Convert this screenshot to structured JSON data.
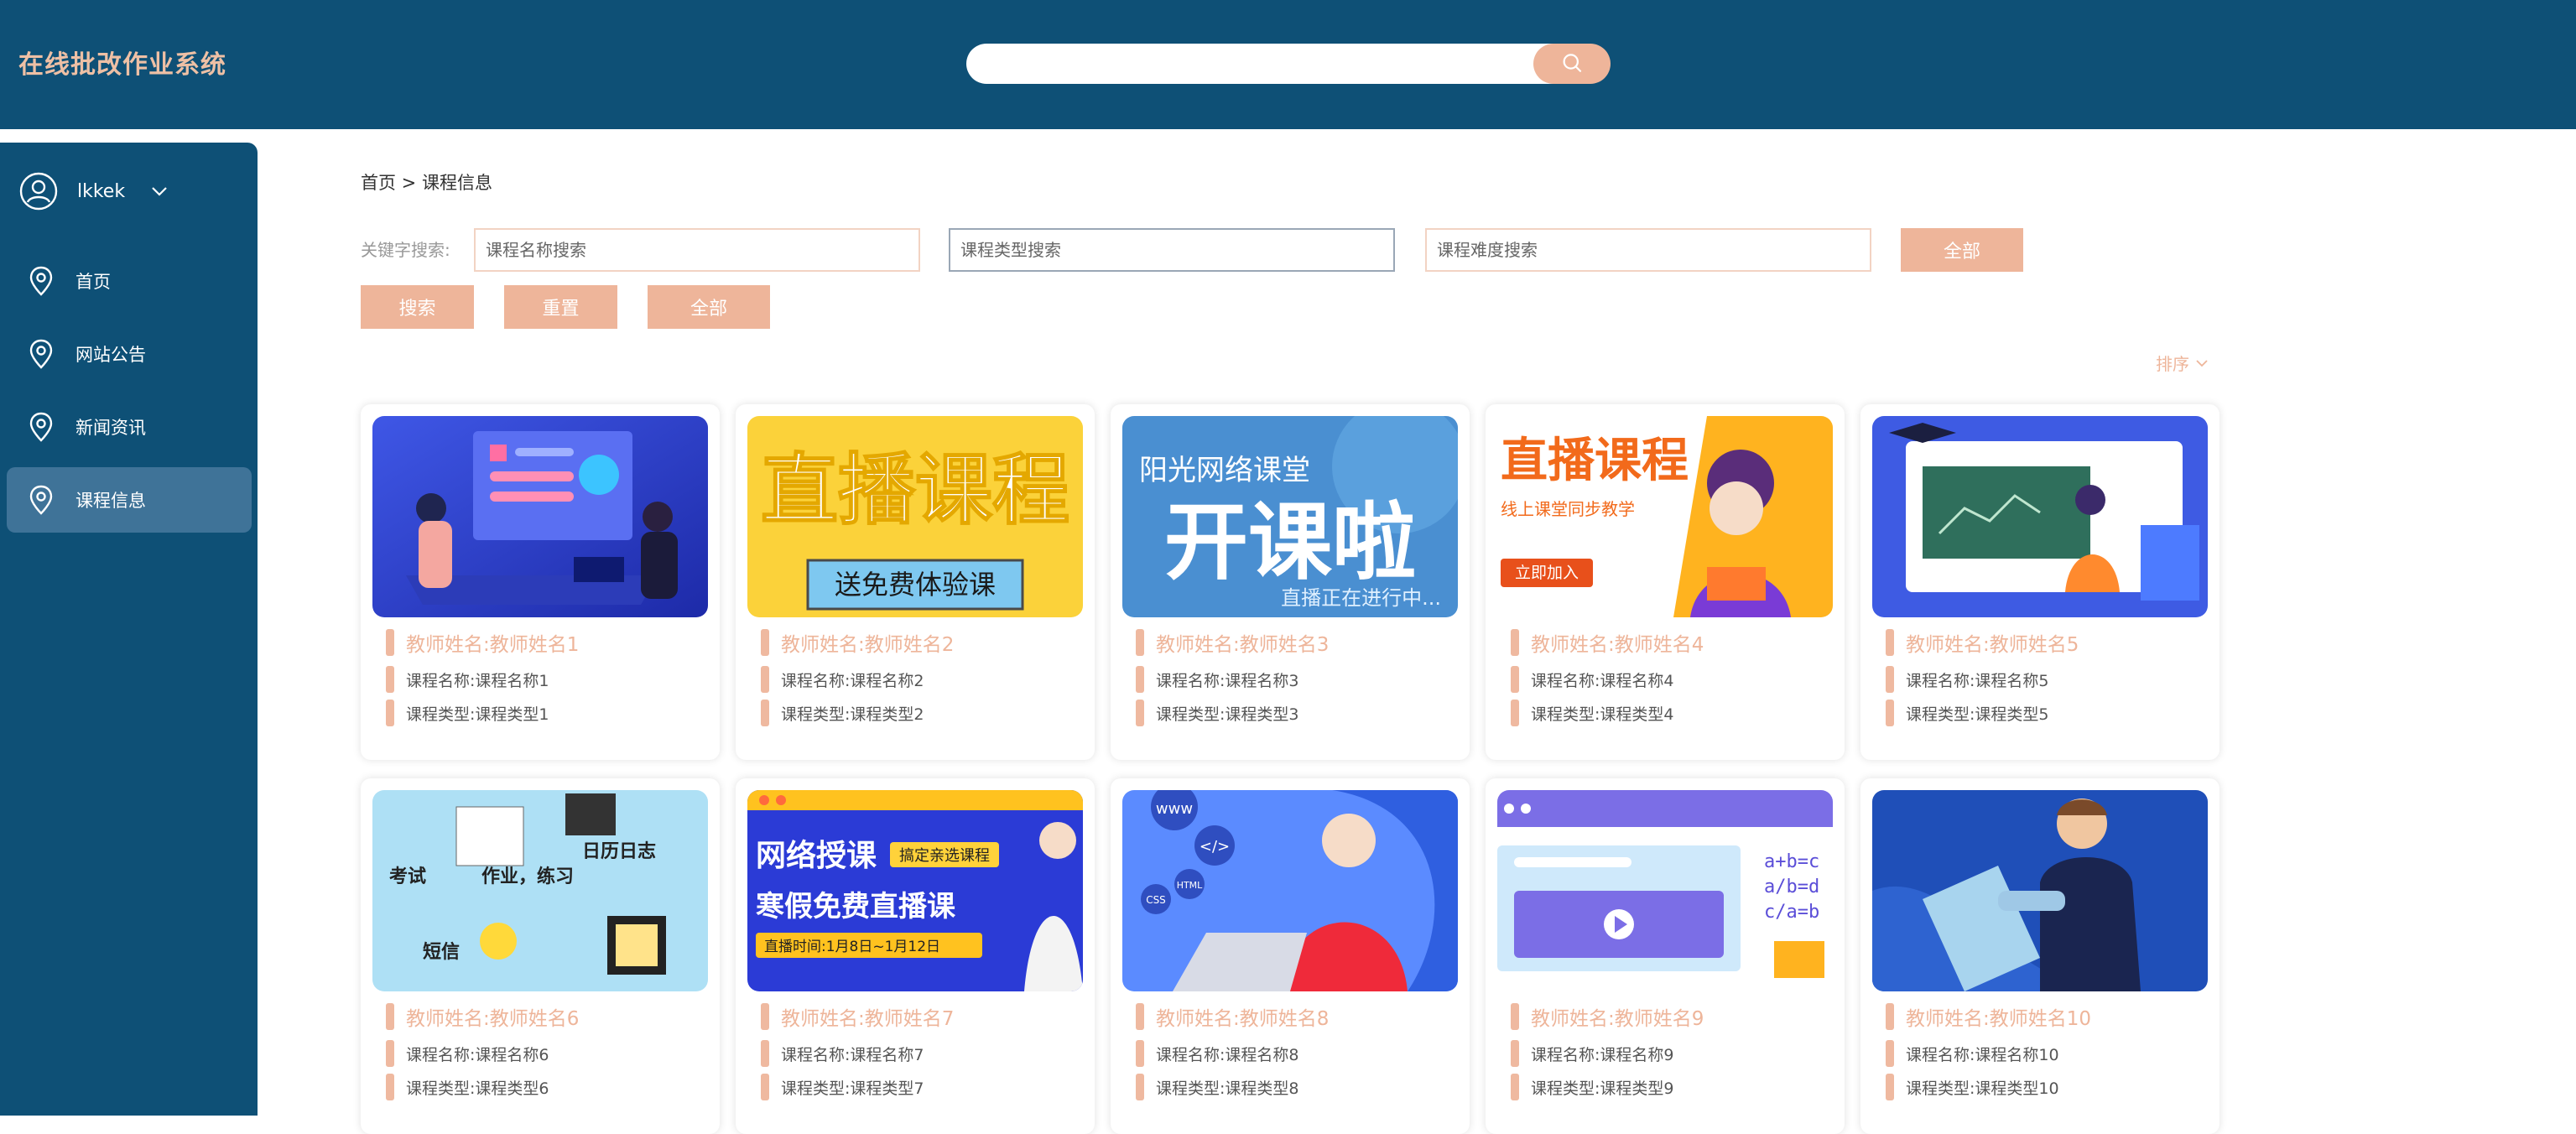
{
  "header": {
    "app_title": "在线批改作业系统",
    "search_placeholder": ""
  },
  "sidebar": {
    "username": "lkkek",
    "items": [
      {
        "label": "首页",
        "active": false
      },
      {
        "label": "网站公告",
        "active": false
      },
      {
        "label": "新闻资讯",
        "active": false
      },
      {
        "label": "课程信息",
        "active": true
      }
    ]
  },
  "breadcrumb": "首页 > 课程信息",
  "filters": {
    "keyword_label": "关键字搜索:",
    "name_placeholder": "课程名称搜索",
    "type_placeholder": "课程类型搜索",
    "difficulty_placeholder": "课程难度搜索",
    "all_label_top": "全部",
    "search_label": "搜索",
    "reset_label": "重置",
    "all_label": "全部"
  },
  "sort_label": "排序",
  "colors": {
    "header_bg": "#0e5076",
    "accent": "#eeb59a",
    "active_nav": "#3f7398"
  },
  "cards": [
    {
      "teacher": "教师姓名:教师姓名1",
      "course": "课程名称:课程名称1",
      "type": "课程类型:课程类型1"
    },
    {
      "teacher": "教师姓名:教师姓名2",
      "course": "课程名称:课程名称2",
      "type": "课程类型:课程类型2",
      "banner_title": "直播课程",
      "banner_sub": "送免费体验课"
    },
    {
      "teacher": "教师姓名:教师姓名3",
      "course": "课程名称:课程名称3",
      "type": "课程类型:课程类型3",
      "banner_title": "阳光网络课堂",
      "banner_big": "开课啦",
      "banner_sub": "直播正在进行中..."
    },
    {
      "teacher": "教师姓名:教师姓名4",
      "course": "课程名称:课程名称4",
      "type": "课程类型:课程类型4",
      "banner_title": "直播课程",
      "banner_sub": "线上课堂同步教学",
      "banner_btn": "立即加入"
    },
    {
      "teacher": "教师姓名:教师姓名5",
      "course": "课程名称:课程名称5",
      "type": "课程类型:课程类型5"
    },
    {
      "teacher": "教师姓名:教师姓名6",
      "course": "课程名称:课程名称6",
      "type": "课程类型:课程类型6",
      "w1": "考试",
      "w2": "作业，练习",
      "w3": "日历日志",
      "w4": "短信"
    },
    {
      "teacher": "教师姓名:教师姓名7",
      "course": "课程名称:课程名称7",
      "type": "课程类型:课程类型7",
      "banner_title": "网络授课",
      "banner_tag": "搞定亲选课程",
      "banner_sub": "寒假免费直播课",
      "banner_time": "直播时间:1月8日~1月12日"
    },
    {
      "teacher": "教师姓名:教师姓名8",
      "course": "课程名称:课程名称8",
      "type": "课程类型:课程类型8",
      "w1": "www",
      "w2": "</>",
      "w3": "CSS",
      "w4": "HTML"
    },
    {
      "teacher": "教师姓名:教师姓名9",
      "course": "课程名称:课程名称9",
      "type": "课程类型:课程类型9",
      "f1": "a+b=c",
      "f2": "a/b=d",
      "f3": "c/a=b"
    },
    {
      "teacher": "教师姓名:教师姓名10",
      "course": "课程名称:课程名称10",
      "type": "课程类型:课程类型10"
    }
  ]
}
